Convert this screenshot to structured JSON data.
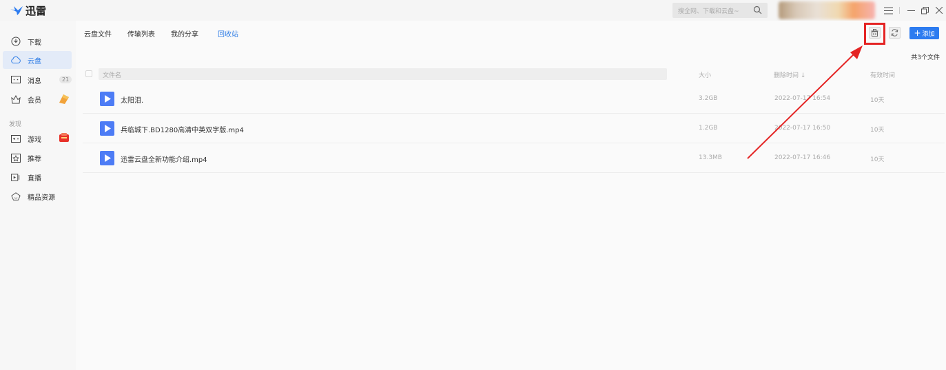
{
  "app": {
    "name": "迅雷"
  },
  "titlebar": {
    "search_placeholder": "搜全网、下载和云盘~"
  },
  "sidebar": {
    "items": [
      {
        "label": "下载",
        "icon": "download-icon"
      },
      {
        "label": "云盘",
        "icon": "cloud-icon",
        "active": true
      },
      {
        "label": "消息",
        "icon": "message-icon",
        "badge": "21"
      },
      {
        "label": "会员",
        "icon": "crown-icon"
      }
    ],
    "section_label": "发现",
    "discover_items": [
      {
        "label": "游戏",
        "icon": "gamepad-icon"
      },
      {
        "label": "推荐",
        "icon": "recommend-icon"
      },
      {
        "label": "直播",
        "icon": "live-icon"
      },
      {
        "label": "精品资源",
        "icon": "diamond-icon"
      }
    ]
  },
  "tabs": [
    {
      "label": "云盘文件"
    },
    {
      "label": "传输列表"
    },
    {
      "label": "我的分享"
    },
    {
      "label": "回收站",
      "active": true
    }
  ],
  "toolbar": {
    "add_label": "添加",
    "file_count": "共3个文件"
  },
  "table": {
    "headers": {
      "name": "文件名",
      "size": "大小",
      "deleted_time": "删除时间",
      "valid_time": "有效时间"
    },
    "rows": [
      {
        "name": "太阳泪.",
        "size": "3.2GB",
        "deleted": "2022-07-17 16:54",
        "valid": "10天"
      },
      {
        "name": "兵临城下.BD1280高清中英双字版.mp4",
        "size": "1.2GB",
        "deleted": "2022-07-17 16:50",
        "valid": "10天"
      },
      {
        "name": "迅雷云盘全新功能介绍.mp4",
        "size": "13.3MB",
        "deleted": "2022-07-17 16:46",
        "valid": "10天"
      }
    ]
  },
  "colors": {
    "accent": "#2d7cf0",
    "file_icon": "#4d7cf5",
    "annotation": "#e42424"
  }
}
